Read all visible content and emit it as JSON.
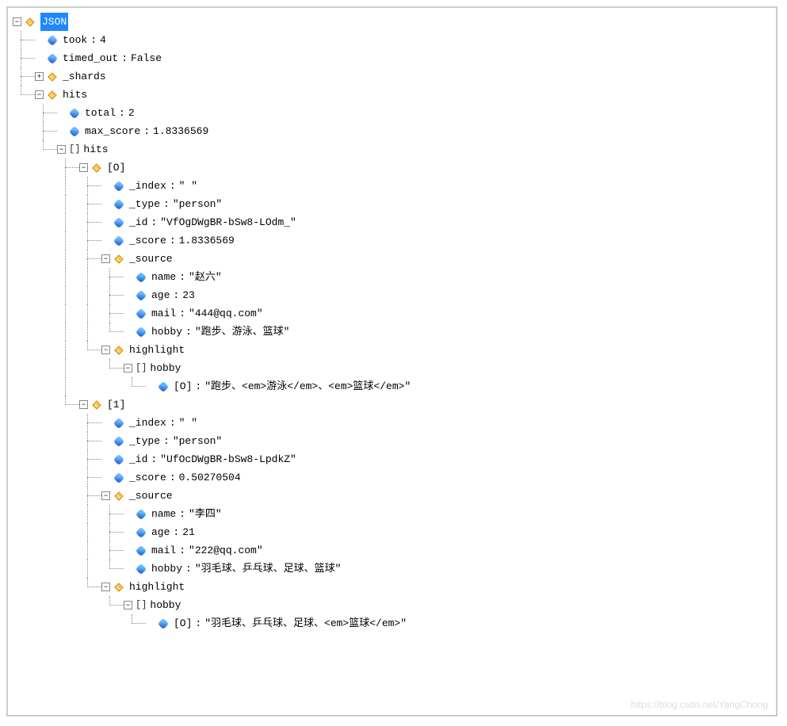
{
  "root": {
    "label": "JSON",
    "highlighted": true
  },
  "took": {
    "key": "took",
    "value": "4"
  },
  "timed_out": {
    "key": "timed_out",
    "value": "False"
  },
  "shards": {
    "key": "_shards"
  },
  "hits_obj": {
    "key": "hits"
  },
  "total": {
    "key": "total",
    "value": "2"
  },
  "max_score": {
    "key": "max_score",
    "value": "1.8336569"
  },
  "hits_arr": {
    "key": "hits"
  },
  "item0": {
    "key": "[O]"
  },
  "i0_index": {
    "key": "_index",
    "value": "\"       \""
  },
  "i0_type": {
    "key": "_type",
    "value": "\"person\""
  },
  "i0_id": {
    "key": "_id",
    "value": "\"VfOgDWgBR-bSw8-LOdm_\""
  },
  "i0_score": {
    "key": "_score",
    "value": "1.8336569"
  },
  "i0_source": {
    "key": "_source"
  },
  "i0_name": {
    "key": "name",
    "value": "\"赵六\""
  },
  "i0_age": {
    "key": "age",
    "value": "23"
  },
  "i0_mail": {
    "key": "mail",
    "value": "\"444@qq.com\""
  },
  "i0_hobby": {
    "key": "hobby",
    "value": "\"跑步、游泳、篮球\""
  },
  "i0_highlight": {
    "key": "highlight"
  },
  "i0_hl_hobby": {
    "key": "hobby"
  },
  "i0_hl_hobby_0": {
    "key": "[O]",
    "value": "\"跑步、<em>游泳</em>、<em>篮球</em>\""
  },
  "item1": {
    "key": "[1]"
  },
  "i1_index": {
    "key": "_index",
    "value": "\"       \""
  },
  "i1_type": {
    "key": "_type",
    "value": "\"person\""
  },
  "i1_id": {
    "key": "_id",
    "value": "\"UfOcDWgBR-bSw8-LpdkZ\""
  },
  "i1_score": {
    "key": "_score",
    "value": "0.50270504"
  },
  "i1_source": {
    "key": "_source"
  },
  "i1_name": {
    "key": "name",
    "value": "\"李四\""
  },
  "i1_age": {
    "key": "age",
    "value": "21"
  },
  "i1_mail": {
    "key": "mail",
    "value": "\"222@qq.com\""
  },
  "i1_hobby": {
    "key": "hobby",
    "value": "\"羽毛球、乒乓球、足球、篮球\""
  },
  "i1_highlight": {
    "key": "highlight"
  },
  "i1_hl_hobby": {
    "key": "hobby"
  },
  "i1_hl_hobby_0": {
    "key": "[O]",
    "value": "\"羽毛球、乒乓球、足球、<em>篮球</em>\""
  },
  "watermark": "https://blog.csdn.net/YangChong"
}
